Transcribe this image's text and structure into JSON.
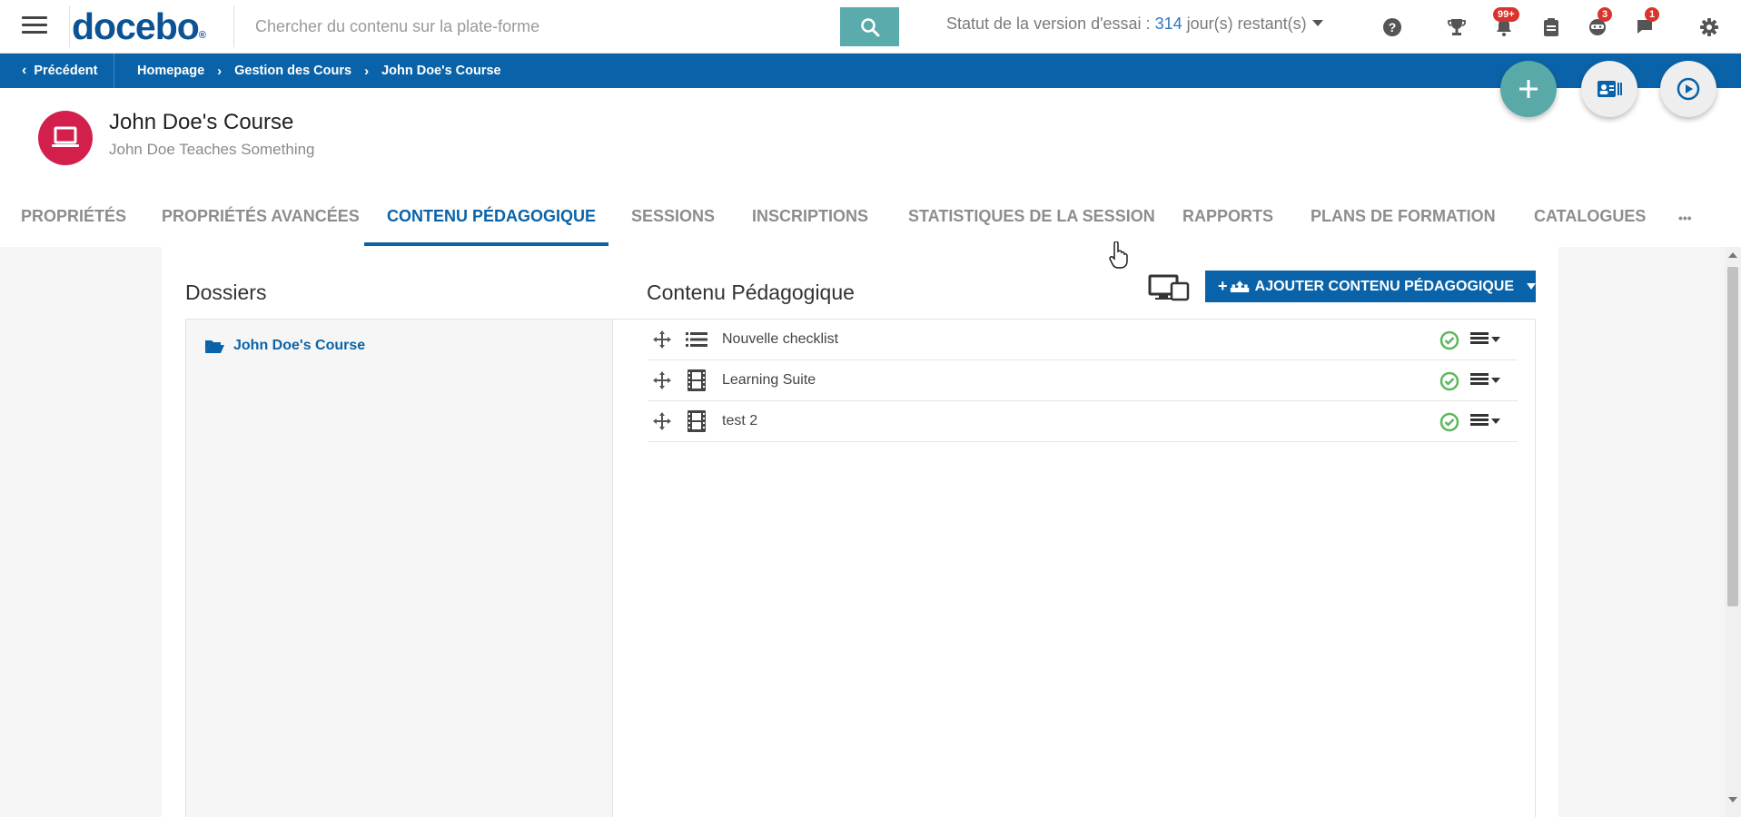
{
  "topbar": {
    "logo": "docebo",
    "logo_mark": "®",
    "search_placeholder": "Chercher du contenu sur la plate-forme",
    "trial_prefix": "Statut de la version d'essai : ",
    "trial_days": "314",
    "trial_suffix": " jour(s) restant(s)",
    "icons": [
      "help-icon",
      "trophy-icon",
      "notifications-icon",
      "clipboard-icon",
      "coach-icon",
      "messages-icon",
      "settings-icon"
    ],
    "badges": {
      "notifications": "99+",
      "coach": "3",
      "messages": "1"
    }
  },
  "breadcrumb": {
    "back_label": "Précédent",
    "items": [
      "Homepage",
      "Gestion des Cours",
      "John Doe's Course"
    ]
  },
  "course": {
    "title": "John Doe's Course",
    "subtitle": "John Doe Teaches Something"
  },
  "tabs": [
    {
      "label": "PROPRIÉTÉS"
    },
    {
      "label": "PROPRIÉTÉS AVANCÉES"
    },
    {
      "label": "CONTENU PÉDAGOGIQUE",
      "active": true
    },
    {
      "label": "SESSIONS"
    },
    {
      "label": "INSCRIPTIONS"
    },
    {
      "label": "STATISTIQUES DE LA SESSION"
    },
    {
      "label": "RAPPORTS"
    },
    {
      "label": "PLANS DE FORMATION"
    },
    {
      "label": "CATALOGUES"
    }
  ],
  "more_tabs": "•••",
  "folders": {
    "heading": "Dossiers",
    "items": [
      "John Doe's Course"
    ]
  },
  "content": {
    "heading": "Contenu Pédagogique",
    "add_button": "AJOUTER CONTENU PÉDAGOGIQUE",
    "rows": [
      {
        "title": "Nouvelle checklist",
        "type_icon": "list-icon",
        "status": "published"
      },
      {
        "title": "Learning Suite",
        "type_icon": "film-icon",
        "status": "published"
      },
      {
        "title": "test 2",
        "type_icon": "film-icon",
        "status": "published"
      }
    ]
  },
  "colors": {
    "brand_blue": "#0a63a8",
    "teal": "#5aabab",
    "course_icon": "#d31f4c",
    "badge_red": "#d9342b",
    "status_green": "#5cb85c"
  }
}
